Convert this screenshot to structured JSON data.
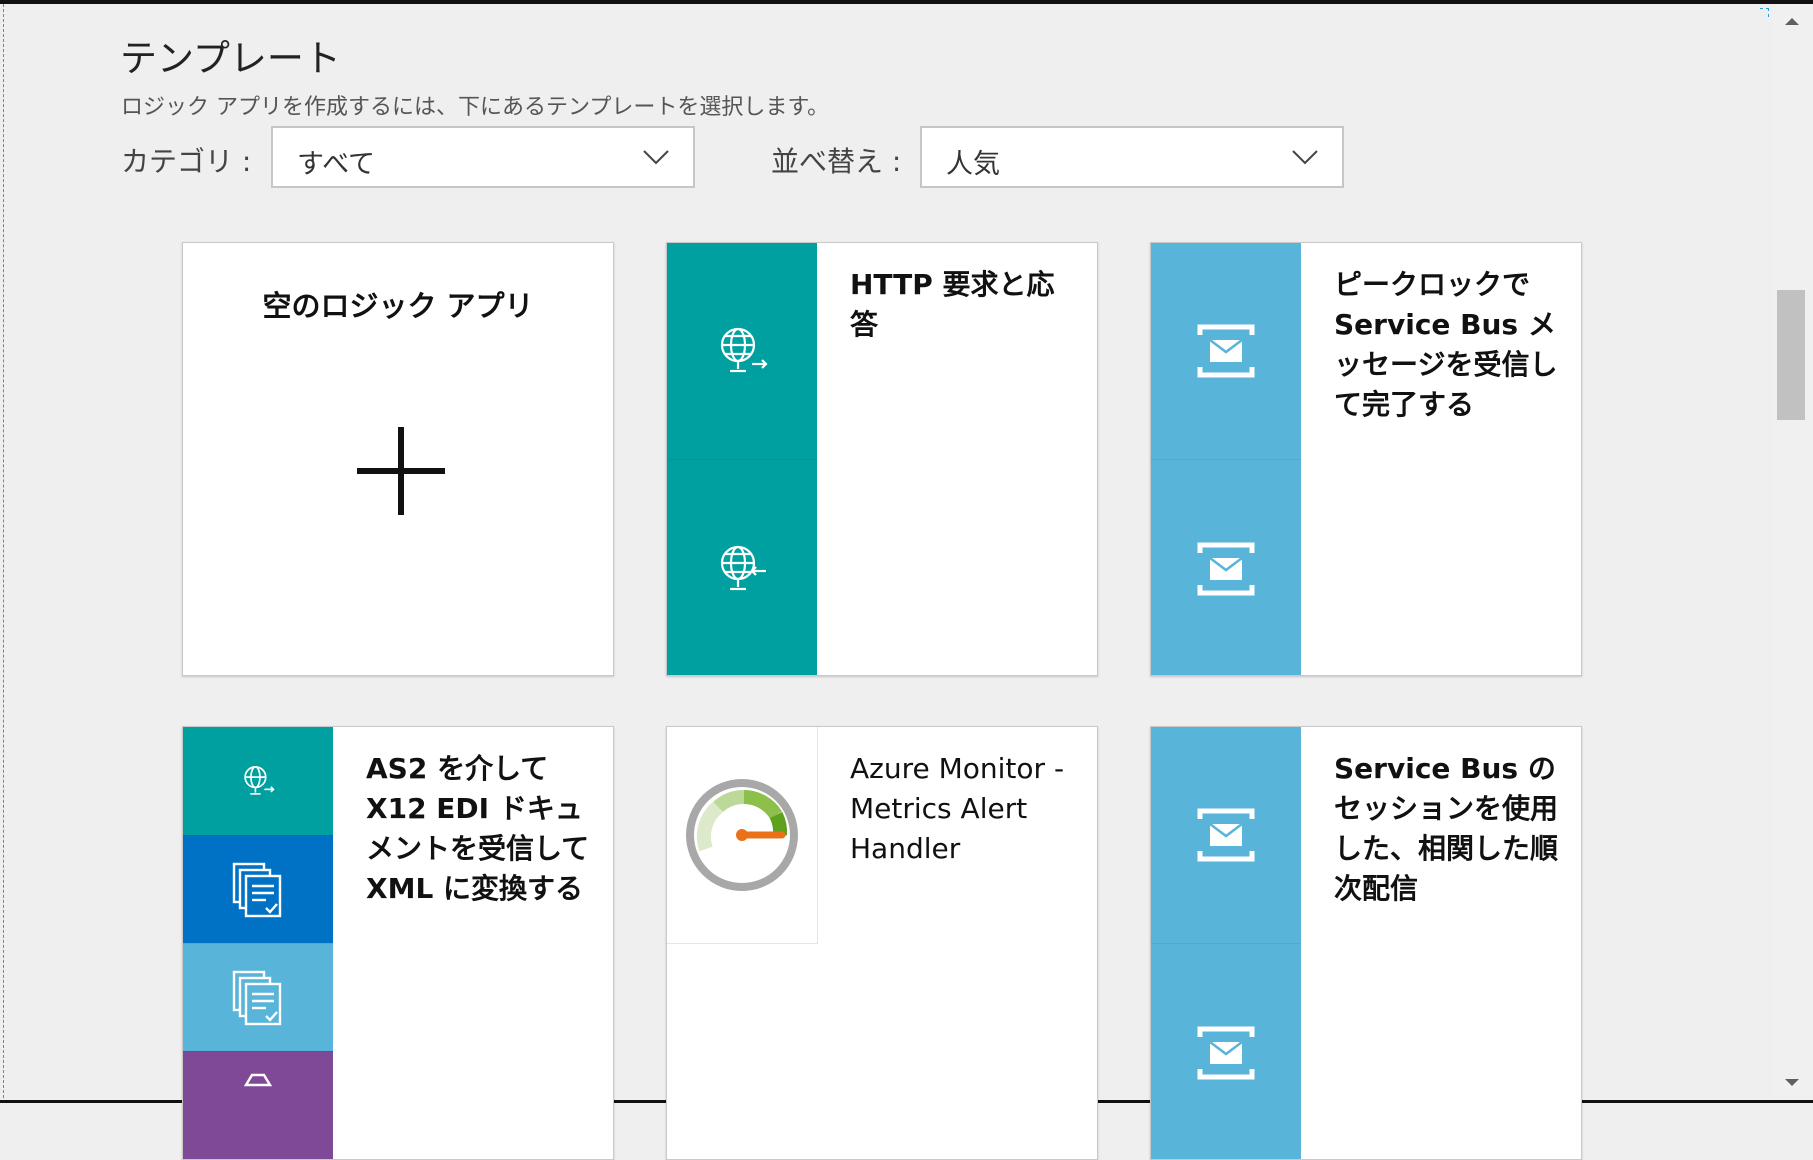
{
  "header": {
    "title": "テンプレート",
    "subtitle": "ロジック アプリを作成するには、下にあるテンプレートを選択します。"
  },
  "filters": {
    "category_label": "カテゴリ :",
    "category_value": "すべて",
    "sort_label": "並べ替え :",
    "sort_value": "人気"
  },
  "templates": [
    {
      "title": "空のロジック アプリ"
    },
    {
      "title": "HTTP 要求と応答"
    },
    {
      "title": "ピークロックで Service Bus メッセージを受信して完了する"
    },
    {
      "title": "AS2 を介して X12 EDI ドキュメントを受信して XML に変換する"
    },
    {
      "title": "Azure Monitor - Metrics Alert Handler"
    },
    {
      "title": "Service Bus のセッションを使用した、相関した順次配信"
    }
  ],
  "colors": {
    "teal": "#00a0a0",
    "servicebus_blue": "#59b4d9",
    "azure_blue": "#0072c6",
    "purple": "#804998",
    "background": "#efefef"
  },
  "icons": [
    "chevron-down-icon",
    "plus-icon",
    "globe-request-icon",
    "globe-response-icon",
    "service-bus-icon",
    "document-icon",
    "gauge-icon",
    "scroll-up-arrow-icon",
    "scroll-down-arrow-icon"
  ]
}
